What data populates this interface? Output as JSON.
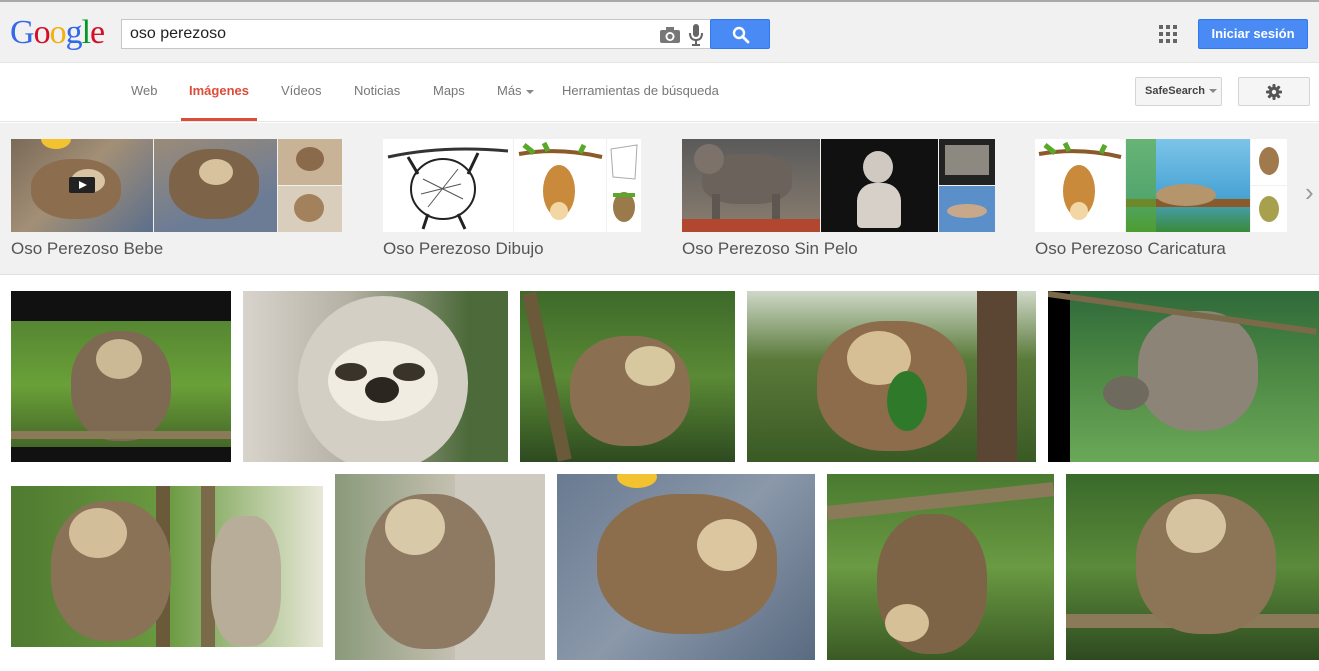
{
  "logo": {
    "letters": [
      "G",
      "o",
      "o",
      "g",
      "l",
      "e"
    ],
    "colors": [
      "#3369e8",
      "#d50f25",
      "#eeb211",
      "#3369e8",
      "#009925",
      "#d50f25"
    ]
  },
  "search": {
    "query": "oso perezoso",
    "camera_icon": "camera-icon",
    "mic_icon": "microphone-icon",
    "search_icon": "magnifier-icon"
  },
  "header": {
    "signin_label": "Iniciar sesión",
    "apps_icon": "apps-grid-icon",
    "accent": "#4a8af4"
  },
  "tabs": [
    {
      "label": "Web",
      "active": false
    },
    {
      "label": "Imágenes",
      "active": true
    },
    {
      "label": "Vídeos",
      "active": false
    },
    {
      "label": "Noticias",
      "active": false
    },
    {
      "label": "Maps",
      "active": false
    },
    {
      "label": "Más",
      "active": false
    },
    {
      "label": "Herramientas de búsqueda",
      "active": false
    }
  ],
  "toolbar": {
    "safesearch_label": "SafeSearch",
    "settings_icon": "gear-icon",
    "active_color": "#dd4b39"
  },
  "related_searches": [
    {
      "label": "Oso Perezoso Bebe"
    },
    {
      "label": "Oso Perezoso Dibujo"
    },
    {
      "label": "Oso Perezoso Sin Pelo"
    },
    {
      "label": "Oso Perezoso Caricatura"
    }
  ],
  "related_next_icon": "chevron-right-icon"
}
